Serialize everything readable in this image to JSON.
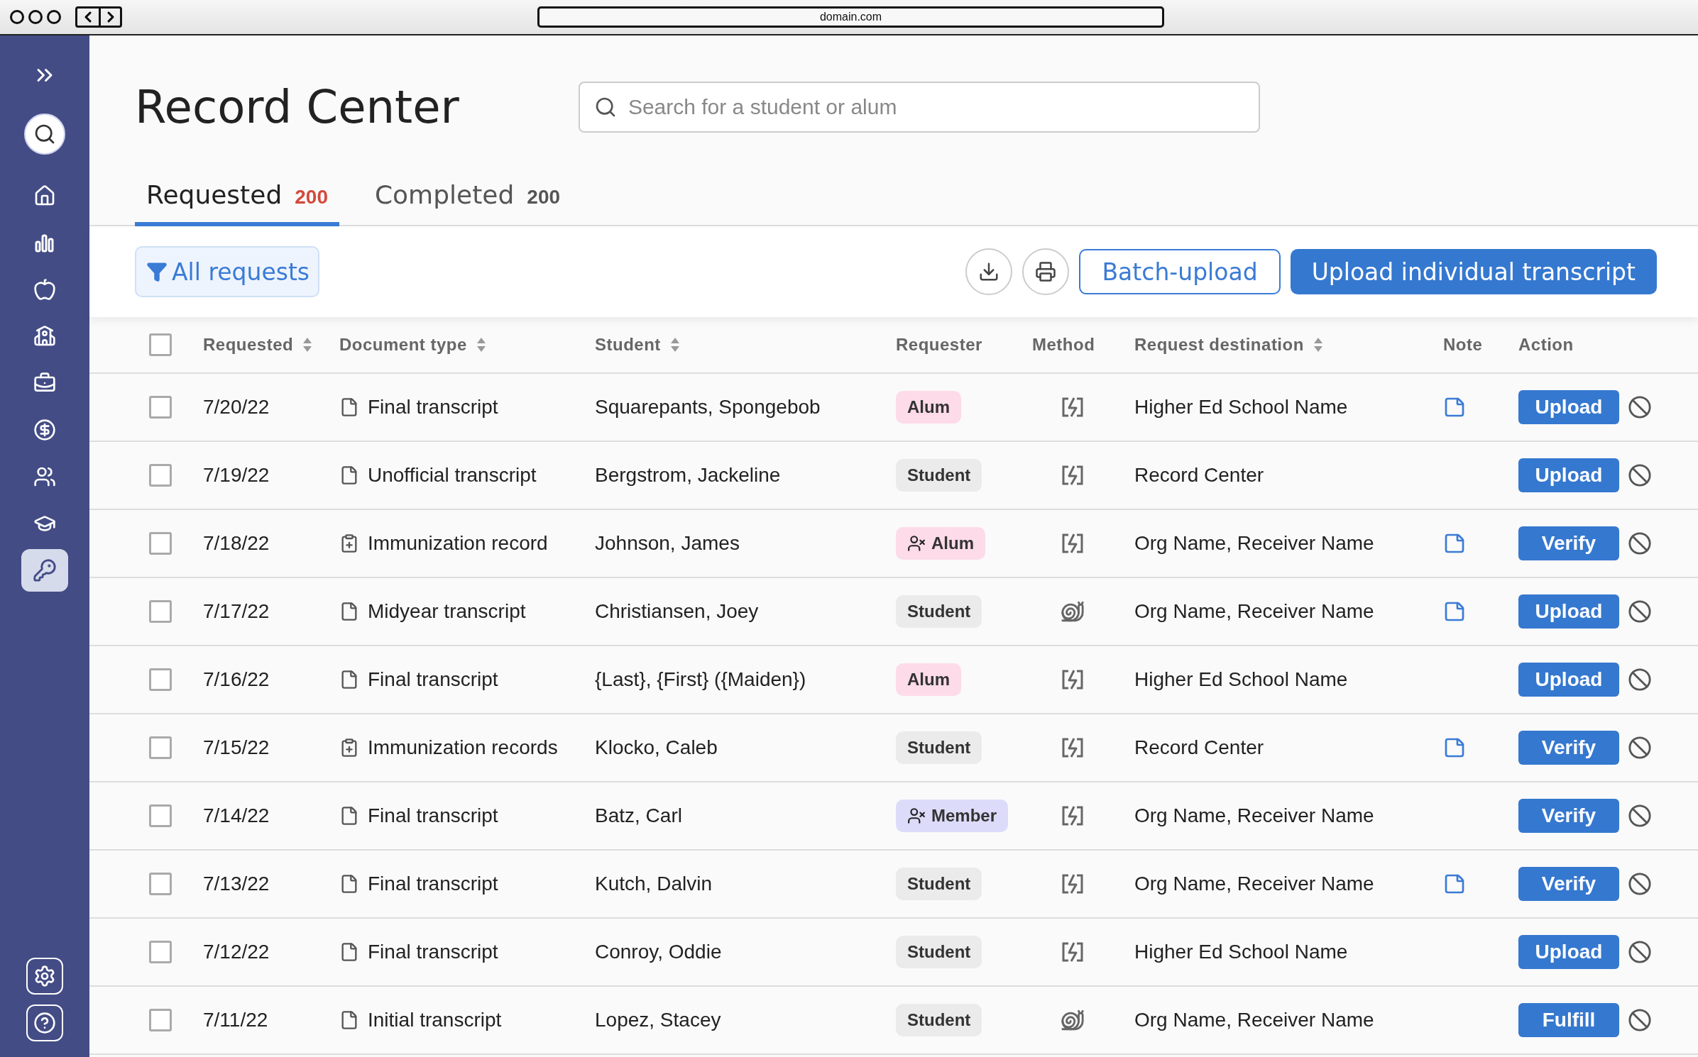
{
  "browser": {
    "url": "domain.com"
  },
  "sidebar": {
    "items": [
      {
        "kind": "home",
        "selected": false
      },
      {
        "kind": "chart",
        "selected": false
      },
      {
        "kind": "apple",
        "selected": false
      },
      {
        "kind": "school",
        "selected": false
      },
      {
        "kind": "briefcase",
        "selected": false
      },
      {
        "kind": "money",
        "selected": false
      },
      {
        "kind": "users",
        "selected": false
      },
      {
        "kind": "graduation",
        "selected": false
      },
      {
        "kind": "key",
        "selected": true
      }
    ]
  },
  "header": {
    "title": "Record Center",
    "search": {
      "placeholder": "Search for a student or alum"
    }
  },
  "tabs": [
    {
      "label": "Requested",
      "count": "200",
      "selected": true
    },
    {
      "label": "Completed",
      "count": "200",
      "selected": false
    }
  ],
  "toolbar": {
    "filter": "All requests",
    "batch": "Batch-upload",
    "upload": "Upload individual transcript"
  },
  "table": {
    "select_all": {
      "checked": false
    },
    "columns": [
      {
        "label": "Requested",
        "sortable": true
      },
      {
        "label": "Document type",
        "sortable": true
      },
      {
        "label": "Student",
        "sortable": true
      },
      {
        "label": "Requester",
        "sortable": false
      },
      {
        "label": "Method",
        "sortable": false
      },
      {
        "label": "Request destination",
        "sortable": true
      },
      {
        "label": "Note",
        "sortable": false
      },
      {
        "label": "Action",
        "sortable": false
      }
    ],
    "rows": [
      {
        "checked": false,
        "date": "7/20/22",
        "document": {
          "kind": "file",
          "label": "Final transcript"
        },
        "student": "Squarepants, Spongebob",
        "requester": {
          "label": "Alum",
          "color": "#fddbe8",
          "restricted": false
        },
        "method": {
          "kind": "lightning"
        },
        "destination": "Higher Ed School Name",
        "note": true,
        "action": "Upload"
      },
      {
        "checked": false,
        "date": "7/19/22",
        "document": {
          "kind": "file",
          "label": "Unofficial transcript"
        },
        "student": "Bergstrom, Jackeline",
        "requester": {
          "label": "Student",
          "color": "#ebebeb",
          "restricted": false
        },
        "method": {
          "kind": "lightning"
        },
        "destination": "Record Center",
        "note": false,
        "action": "Upload"
      },
      {
        "checked": false,
        "date": "7/18/22",
        "document": {
          "kind": "medical",
          "label": "Immunization record"
        },
        "student": "Johnson, James",
        "requester": {
          "label": "Alum",
          "color": "#fddbe8",
          "restricted": true
        },
        "method": {
          "kind": "lightning"
        },
        "destination": "Org Name, Receiver Name",
        "note": true,
        "action": "Verify"
      },
      {
        "checked": false,
        "date": "7/17/22",
        "document": {
          "kind": "file",
          "label": "Midyear transcript"
        },
        "student": "Christiansen, Joey",
        "requester": {
          "label": "Student",
          "color": "#ebebeb",
          "restricted": false
        },
        "method": {
          "kind": "snail"
        },
        "destination": "Org Name, Receiver Name",
        "note": true,
        "action": "Upload"
      },
      {
        "checked": false,
        "date": "7/16/22",
        "document": {
          "kind": "file",
          "label": "Final transcript"
        },
        "student": "{Last}, {First} ({Maiden})",
        "requester": {
          "label": "Alum",
          "color": "#fddbe8",
          "restricted": false
        },
        "method": {
          "kind": "lightning"
        },
        "destination": "Higher Ed School Name",
        "note": false,
        "action": "Upload"
      },
      {
        "checked": false,
        "date": "7/15/22",
        "document": {
          "kind": "medical",
          "label": "Immunization records"
        },
        "student": "Klocko, Caleb",
        "requester": {
          "label": "Student",
          "color": "#ebebeb",
          "restricted": false
        },
        "method": {
          "kind": "lightning"
        },
        "destination": "Record Center",
        "note": true,
        "action": "Verify"
      },
      {
        "checked": false,
        "date": "7/14/22",
        "document": {
          "kind": "file",
          "label": "Final transcript"
        },
        "student": "Batz, Carl",
        "requester": {
          "label": "Member",
          "color": "#dcdcfa",
          "restricted": true
        },
        "method": {
          "kind": "lightning"
        },
        "destination": "Org Name, Receiver Name",
        "note": false,
        "action": "Verify"
      },
      {
        "checked": false,
        "date": "7/13/22",
        "document": {
          "kind": "file",
          "label": "Final transcript"
        },
        "student": "Kutch, Dalvin",
        "requester": {
          "label": "Student",
          "color": "#ebebeb",
          "restricted": false
        },
        "method": {
          "kind": "lightning"
        },
        "destination": "Org Name, Receiver Name",
        "note": true,
        "action": "Verify"
      },
      {
        "checked": false,
        "date": "7/12/22",
        "document": {
          "kind": "file",
          "label": "Final transcript"
        },
        "student": "Conroy, Oddie",
        "requester": {
          "label": "Student",
          "color": "#ebebeb",
          "restricted": false
        },
        "method": {
          "kind": "lightning"
        },
        "destination": "Higher Ed School Name",
        "note": false,
        "action": "Upload"
      },
      {
        "checked": false,
        "date": "7/11/22",
        "document": {
          "kind": "file",
          "label": "Initial transcript"
        },
        "student": "Lopez, Stacey",
        "requester": {
          "label": "Student",
          "color": "#ebebeb",
          "restricted": false
        },
        "method": {
          "kind": "snail"
        },
        "destination": "Org Name, Receiver Name",
        "note": false,
        "action": "Fulfill"
      }
    ]
  }
}
